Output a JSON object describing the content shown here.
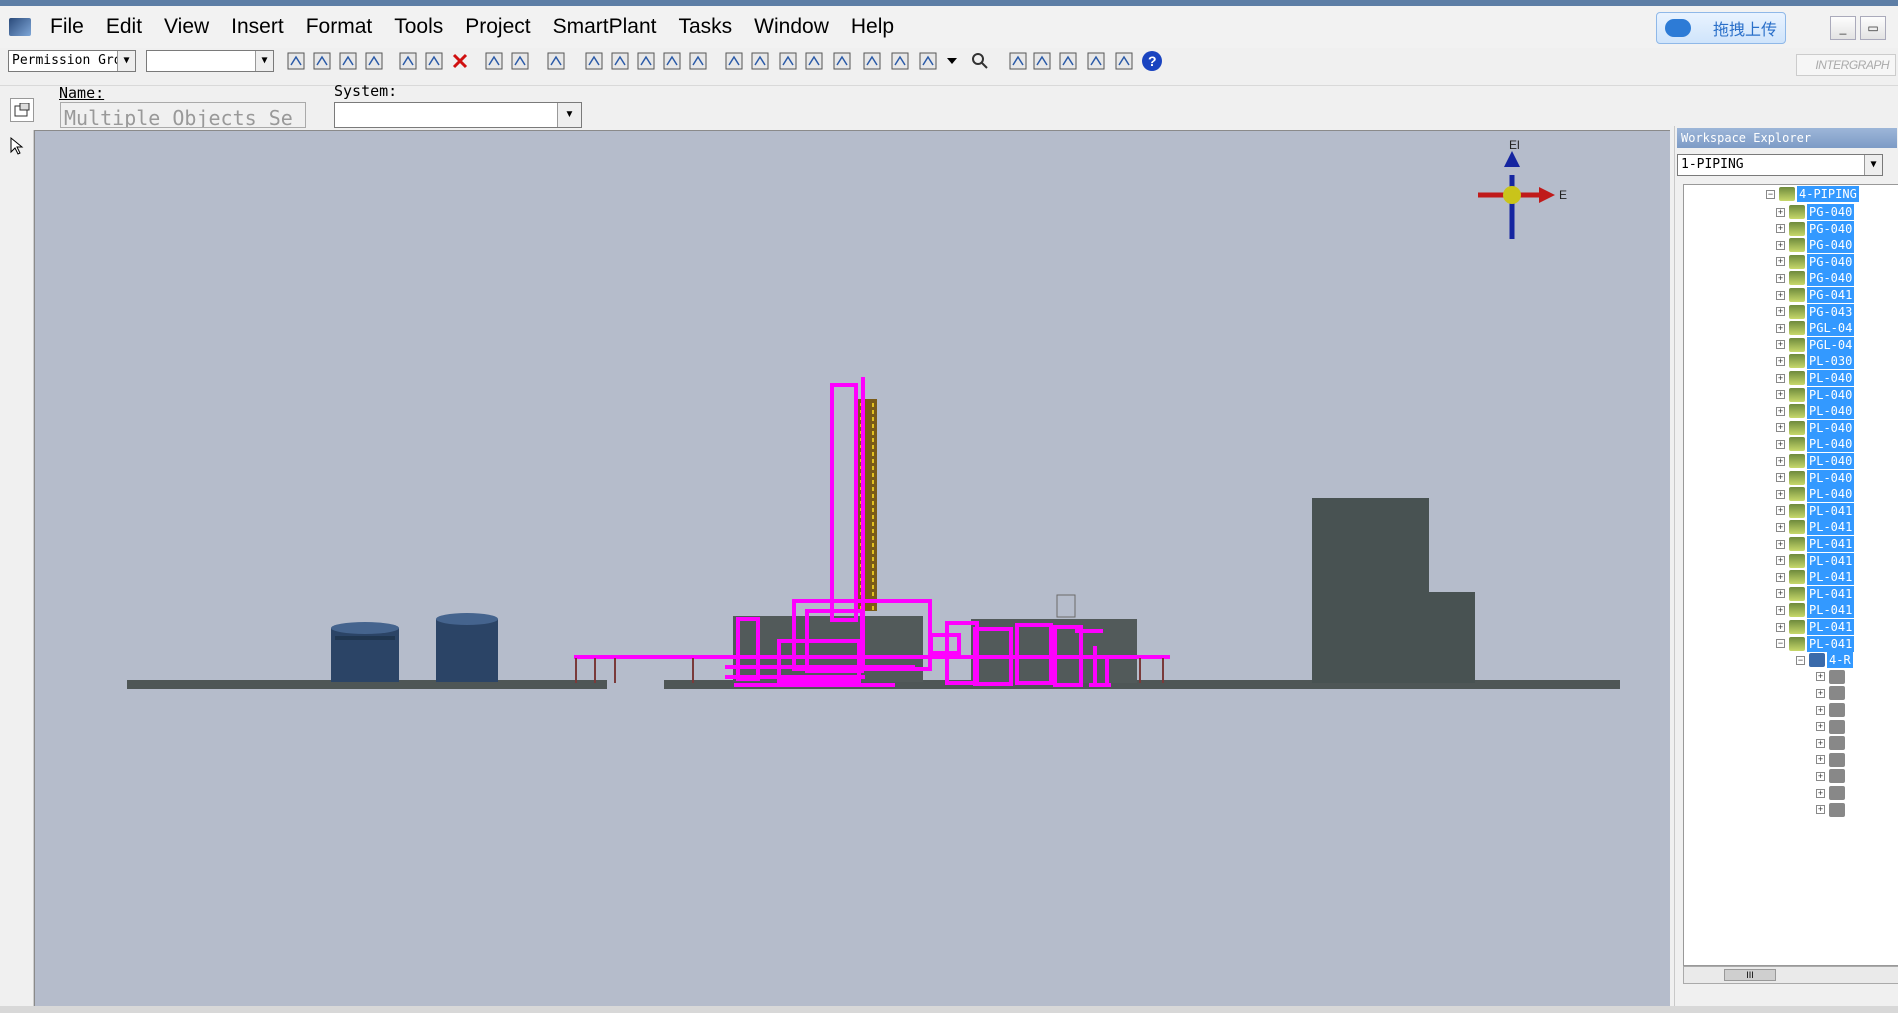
{
  "menu": [
    "File",
    "Edit",
    "View",
    "Insert",
    "Format",
    "Tools",
    "Project",
    "SmartPlant",
    "Tasks",
    "Window",
    "Help"
  ],
  "upload_button": "拖拽上传",
  "window_controls": {
    "minimize": "_",
    "restore": "▭"
  },
  "toolbar": {
    "permission_group": "Permission Gro",
    "empty_combo": ""
  },
  "intergraph_logo": "INTERGRAPH",
  "properties": {
    "name_label": "Name:",
    "name_value": "Multiple Objects Se",
    "system_label": "System:",
    "system_value": ""
  },
  "compass": {
    "up_label": "El",
    "east_label": "E"
  },
  "explorer": {
    "title": "Workspace Explorer",
    "filter": "1-PIPING",
    "root": "4-PIPING",
    "items": [
      "PG-040",
      "PG-040",
      "PG-040",
      "PG-040",
      "PG-040",
      "PG-041",
      "PG-043",
      "PGL-04",
      "PGL-04",
      "PL-030",
      "PL-040",
      "PL-040",
      "PL-040",
      "PL-040",
      "PL-040",
      "PL-040",
      "PL-040",
      "PL-040",
      "PL-041",
      "PL-041",
      "PL-041",
      "PL-041",
      "PL-041",
      "PL-041",
      "PL-041",
      "PL-041",
      "PL-041"
    ],
    "sub_item": "4-R",
    "scroll_thumb": "III"
  },
  "colors": {
    "viewport_bg": "#b5bccb",
    "pipe_highlight": "#ff00ff",
    "selection": "#3399ff"
  }
}
